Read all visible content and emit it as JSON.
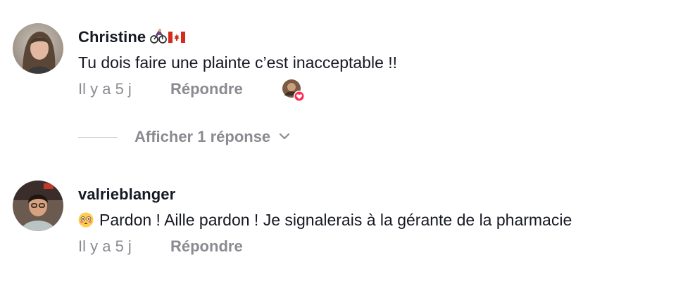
{
  "comments": [
    {
      "username": "Christine",
      "flair_icons": [
        "cyclist-emoji-icon",
        "canada-flag-icon"
      ],
      "text": "Tu dois faire une plainte c’est inacceptable !!",
      "time": "Il y a 5 j",
      "reply_label": "Répondre",
      "creator_liked": true,
      "view_replies_label": "Afficher 1 réponse"
    },
    {
      "username": "valrieblanger",
      "text_emoji": "flushed-face-emoji-icon",
      "text": "Pardon ! Aille pardon ! Je signalerais à la gérante de la pharmacie",
      "time": "Il y a 5 j",
      "reply_label": "Répondre"
    }
  ],
  "colors": {
    "text_primary": "#161823",
    "text_secondary": "#8a8b91",
    "like_badge": "#fe2c55"
  }
}
